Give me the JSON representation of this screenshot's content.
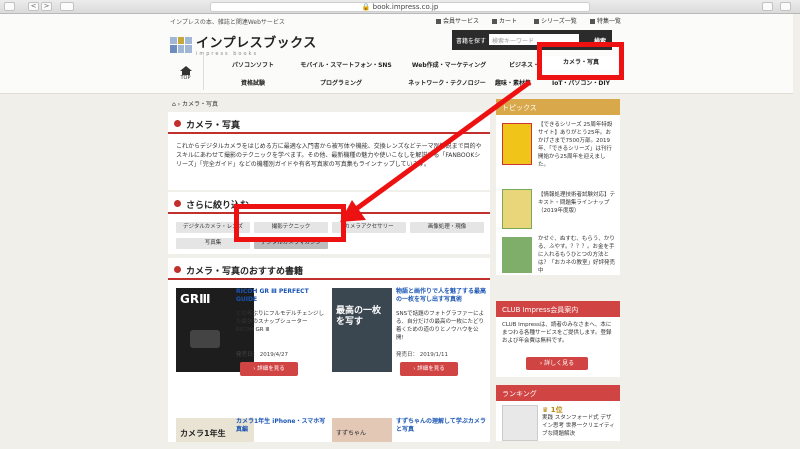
{
  "browser": {
    "url": "book.impress.co.jp",
    "back": "<",
    "forward": ">"
  },
  "header": {
    "tagline": "インプレスの本、雑誌と関連Webサービス",
    "links": [
      "会員サービス",
      "カート",
      "シリーズ一覧",
      "特集一覧"
    ],
    "logo_text": "インプレスブックス",
    "logo_sub": "impress books",
    "search_label": "書籍を探す",
    "search_placeholder": "検索キーワード",
    "search_button": "検索"
  },
  "nav": {
    "top": "TOP",
    "items": [
      "パソコンソフト",
      "モバイル・スマートフォン・SNS",
      "Web作成・マーケティング",
      "ビジネス・読み物",
      "カメラ・写真",
      "資格試験",
      "プログラミング",
      "ネットワーク・テクノロジー",
      "趣味・素材集",
      "IoT・パソコン・DIY"
    ]
  },
  "breadcrumb": "カメラ・写真",
  "category": {
    "title": "カメラ・写真",
    "description": "これからデジタルカメラをはじめる方に最適な入門書から被写体や機能、交換レンズなどテーマ別解説まで目的やスキルにあわせて撮影のテクニックを学べます。その他、最新機種の魅力や使いこなしを解説する「FANBOOKシリーズ」「完全ガイド」などの機種別ガイドや有名写真家の写真集もラインナップしています。"
  },
  "filter": {
    "title": "さらに絞り込む",
    "tags": [
      "デジタルカメラ・レンズ",
      "撮影テクニック",
      "カメラアクセサリー",
      "画像処理・現像",
      "写真集",
      "デジタルカメラマガジン"
    ]
  },
  "recommended": {
    "title": "カメラ・写真のおすすめ書籍",
    "books": [
      {
        "title": "RICOH GR Ⅲ PERFECT GUIDE",
        "desc": "との年ぶりにフルモデルチェンジした最強のスナップシューター RICOH GR Ⅲ",
        "date": "発売日： 2019/4/27",
        "button": "詳細を見る",
        "cover": "GRⅢ"
      },
      {
        "title": "物語と画作りで人を魅了する最高の一枚を写し出す写真術",
        "desc": "SNSで話題のフォトグラファーによる、自分だけの最高の一枚にたどり着くための道のりとノウハウを公開!",
        "date": "発売日： 2019/1/11",
        "button": "詳細を見る",
        "cover": "最高の一枚を写す"
      },
      {
        "title": "カメラ1年生 iPhone・スマホ写真編",
        "cover": "カメラ1年生"
      },
      {
        "title": "すずちゃんの理解して学ぶカメラと写真",
        "cover": "すずちゃん"
      }
    ]
  },
  "sidebar": {
    "topics_title": "トピックス",
    "topics": [
      {
        "text": "【できるシリーズ 25周年特設サイト】ありがとう25年。おかげさまで7500万部。2019年、「できるシリーズ」は刊行開始から25周年を迎えました。"
      },
      {
        "text": "【情報処理技術者試験対応】テキスト・問題集ラインナップ（2019年度版）"
      },
      {
        "text": "かせぐ、ぬすむ、もらう、かりる、ふやす。？？？。お金を手に入れるもうひとつの方法とは？「おカネの教室」好評発売中"
      }
    ],
    "club_title": "CLUB Impress会員案内",
    "club_text": "CLUB Impressは、読者のみなさまへ、本にまつわる各種サービスをご提供します。登録および年会費は無料です。",
    "club_button": "詳しく見る",
    "ranking_title": "ランキング",
    "ranking_rank": "1位",
    "ranking_text": "実践 スタンフォード式 デザイン思考 世界一クリエイティブな問題解決"
  },
  "colors": {
    "accent": "#c0302c",
    "sidebar_header": "#d8a84b",
    "annotation": "#ee1111",
    "button": "#d04443"
  }
}
